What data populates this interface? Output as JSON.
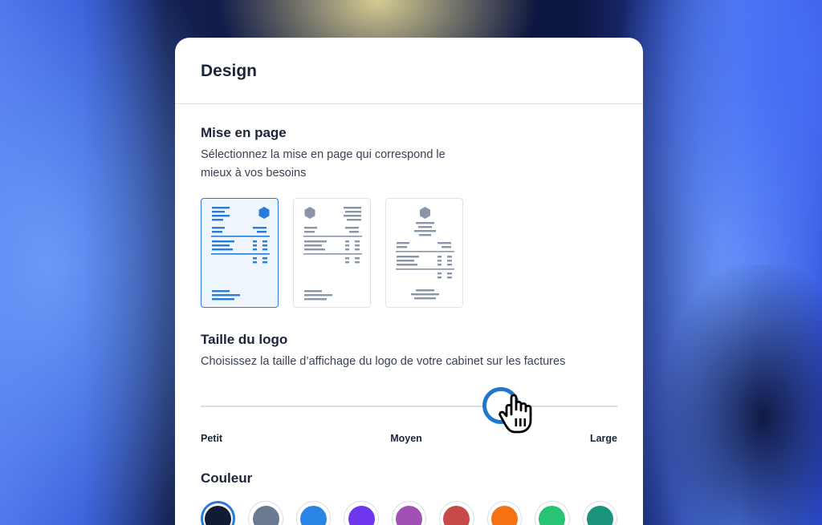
{
  "panel": {
    "title": "Design"
  },
  "layout_section": {
    "title": "Mise en page",
    "description_line1": "Sélectionnez la mise en page qui correspond le",
    "description_line2": "mieux à vos besoins",
    "options": [
      {
        "name": "layout-left-text-right-logo",
        "selected": true
      },
      {
        "name": "layout-left-logo-right-text",
        "selected": false
      },
      {
        "name": "layout-centered",
        "selected": false
      }
    ]
  },
  "logo_section": {
    "title": "Taille du logo",
    "description": "Choisissez la taille d’affichage du logo de votre cabinet sur les factures",
    "slider": {
      "labels": [
        "Petit",
        "Moyen",
        "Large"
      ],
      "value_fraction": 0.72
    }
  },
  "color_section": {
    "title": "Couleur",
    "colors": [
      {
        "name": "navy",
        "hex": "#121b33",
        "selected": true
      },
      {
        "name": "slate",
        "hex": "#6b7a91",
        "selected": false
      },
      {
        "name": "blue",
        "hex": "#2b85e4",
        "selected": false
      },
      {
        "name": "violet",
        "hex": "#6e37ee",
        "selected": false
      },
      {
        "name": "purple",
        "hex": "#a150b6",
        "selected": false
      },
      {
        "name": "red",
        "hex": "#c84a48",
        "selected": false
      },
      {
        "name": "orange",
        "hex": "#f57212",
        "selected": false
      },
      {
        "name": "green",
        "hex": "#27c475",
        "selected": false
      },
      {
        "name": "teal",
        "hex": "#19947b",
        "selected": false
      }
    ]
  },
  "accent_color": "#2a7bd6",
  "icons": {
    "cursor": "hand-grab-icon",
    "logo_placeholder": "hexagon-icon"
  }
}
